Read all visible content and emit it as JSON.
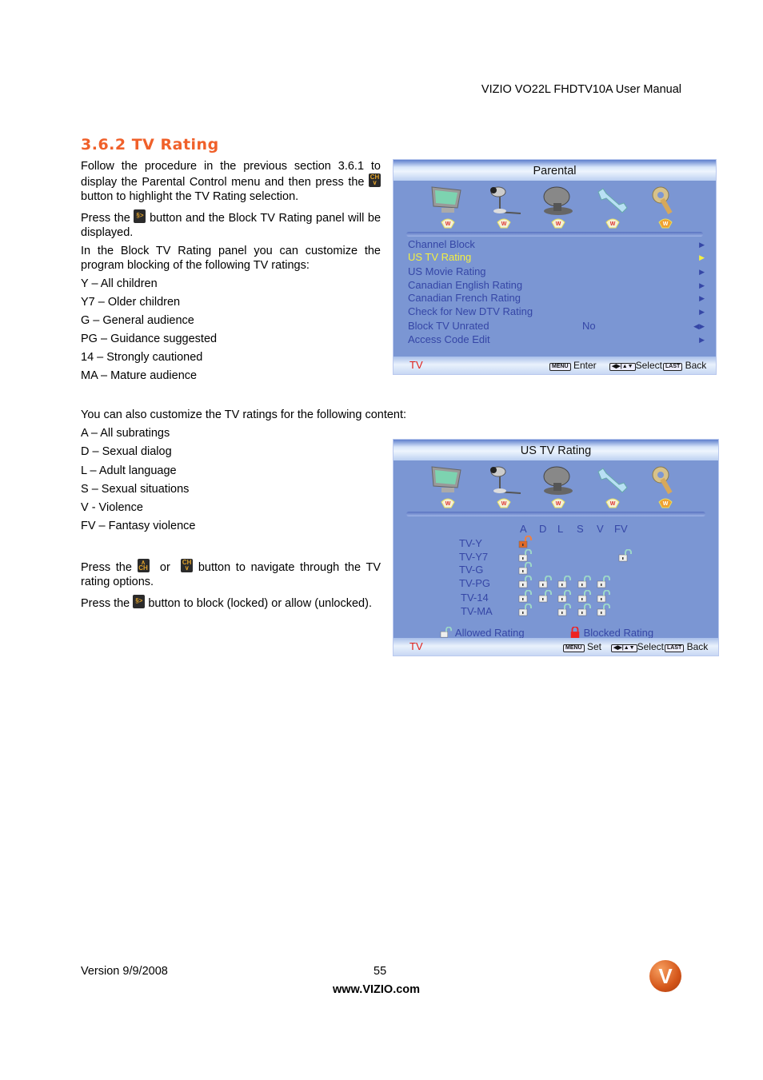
{
  "header": {
    "manual_title": "VIZIO VO22L FHDTV10A User Manual"
  },
  "section": {
    "title": "3.6.2 TV Rating",
    "para1_part1": "Follow the procedure in the previous section 3.6.1 to display the Parental Control menu and then press the",
    "para1_part2": "button to highlight the TV Rating selection.",
    "para2_part1": "Press the",
    "para2_part2": "button and the Block TV Rating panel will be displayed.",
    "para3": "In the Block TV Rating panel you can customize the program blocking of the following TV ratings:",
    "ratings": [
      "Y – All children",
      "Y7 – Older children",
      "G – General audience",
      "PG – Guidance suggested",
      "14 – Strongly cautioned",
      "MA – Mature audience"
    ],
    "content_intro": "You can also customize the TV ratings for the following content:",
    "content_ratings": [
      "A – All subratings",
      "D – Sexual dialog",
      "L – Adult language",
      "S – Sexual situations",
      "V - Violence",
      "FV – Fantasy violence"
    ],
    "nav_part1": "Press the",
    "nav_or": "or",
    "nav_part2": "button to navigate through the TV rating options.",
    "block_part1": "Press the",
    "block_part2": "button to block (locked) or allow (unlocked).",
    "icons": {
      "ch_down": "CH∨",
      "ch_up": "∧CH",
      "enter": "§>"
    }
  },
  "parental_panel": {
    "title": "Parental",
    "icon_tabs": [
      "tv-picture-icon",
      "audio-microphone-icon",
      "satellite-dish-icon",
      "setup-wrench-icon",
      "parental-key-icon"
    ],
    "items": [
      {
        "label": "Channel Block",
        "value": "",
        "arrow": "▶"
      },
      {
        "label": "US TV Rating",
        "value": "",
        "arrow": "▶",
        "active": true
      },
      {
        "label": "US Movie Rating",
        "value": "",
        "arrow": "▶"
      },
      {
        "label": "Canadian English Rating",
        "value": "",
        "arrow": "▶"
      },
      {
        "label": "Canadian French Rating",
        "value": "",
        "arrow": "▶"
      },
      {
        "label": "Check for New DTV Rating",
        "value": "",
        "arrow": "▶"
      },
      {
        "label": "Block TV Unrated",
        "value": "No",
        "arrow": "◀▶"
      },
      {
        "label": "Access Code Edit",
        "value": "",
        "arrow": "▶"
      }
    ],
    "footer": {
      "source": "TV",
      "menu_key": "MENU",
      "menu_action": "Enter",
      "select_key": "◀▶|▲▼",
      "select_action": "Select",
      "last_key": "LAST",
      "last_action": "Back"
    }
  },
  "us_tv_panel": {
    "title": "US TV Rating",
    "columns": [
      "A",
      "D",
      "L",
      "S",
      "V",
      "FV"
    ],
    "rows": [
      {
        "label": "TV-Y",
        "cells": [
          "selected-unlocked",
          null,
          null,
          null,
          null,
          null
        ]
      },
      {
        "label": "TV-Y7",
        "cells": [
          "unlocked",
          null,
          null,
          null,
          null,
          "unlocked"
        ]
      },
      {
        "label": "TV-G",
        "cells": [
          "unlocked",
          null,
          null,
          null,
          null,
          null
        ]
      },
      {
        "label": "TV-PG",
        "cells": [
          "unlocked",
          "unlocked",
          "unlocked",
          "unlocked",
          "unlocked",
          null
        ]
      },
      {
        "label": "TV-14",
        "cells": [
          "unlocked",
          "unlocked",
          "unlocked",
          "unlocked",
          "unlocked",
          null
        ]
      },
      {
        "label": "TV-MA",
        "cells": [
          "unlocked",
          null,
          "unlocked",
          "unlocked",
          "unlocked",
          null
        ]
      }
    ],
    "legend": {
      "allowed": "Allowed  Rating",
      "blocked": "Blocked Rating"
    },
    "footer": {
      "source": "TV",
      "menu_key": "MENU",
      "menu_action": "Set",
      "select_key": "◀▶|▲▼",
      "select_action": "Select",
      "last_key": "LAST",
      "last_action": "Back"
    }
  },
  "colors": {
    "section_title": "#f0602a",
    "osd_bg": "#7b96d3",
    "osd_text": "#3546a6",
    "osd_active": "#f4f040",
    "osd_source": "#e0201a"
  },
  "footer": {
    "version": "Version 9/9/2008",
    "page": "55",
    "website": "www.VIZIO.com",
    "logo": "V"
  }
}
